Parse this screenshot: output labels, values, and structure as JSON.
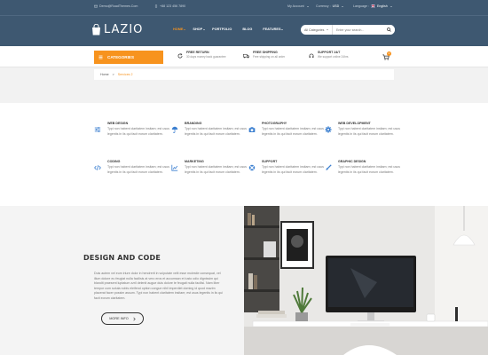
{
  "colors": {
    "header_bg": "#3e5871",
    "accent": "#f7931e",
    "band_bg": "#f2f2f2"
  },
  "topbar": {
    "email": "Demo@RoadThemes.Com",
    "phone": "+88 123 456 7890",
    "account": "My Account",
    "currency_label": "Currency :",
    "currency": "USD",
    "language_label": "Language :",
    "language": "English"
  },
  "header": {
    "logo": "LAZIO",
    "nav": [
      "HOME",
      "SHOP",
      "PORTFOLIO",
      "BLOG",
      "FEATURES"
    ],
    "search": {
      "category": "All Categories",
      "placeholder": "Enter your search..."
    }
  },
  "servicebar": {
    "categories_label": "CATEGORIES",
    "features": [
      {
        "title": "FREE RETURN",
        "subtitle": "30 days money back guarantee"
      },
      {
        "title": "FREE SHIPPING",
        "subtitle": "Free shipping on all order"
      },
      {
        "title": "SUPPORT 24/7",
        "subtitle": "We support online 24hrs"
      }
    ],
    "cart_count": "0"
  },
  "breadcrumb": {
    "home": "Home",
    "sep": ">",
    "current": "Services 2"
  },
  "services": [
    {
      "icon": "sliders-icon",
      "title": "WEB DESIGN",
      "desc": "Typi non habent claritatem insitam; est usus legentis in iis qui facit eorum claritatem."
    },
    {
      "icon": "umbrella-icon",
      "title": "BRANDING",
      "desc": "Typi non habent claritatem insitam; est usus legentis in iis qui facit eorum claritatem."
    },
    {
      "icon": "camera-icon",
      "title": "PHOTOGRAPHY",
      "desc": "Typi non habent claritatem insitam; est usus legentis in iis qui facit eorum claritatem."
    },
    {
      "icon": "gear-icon",
      "title": "WEB DEVELOPMENT",
      "desc": "Typi non habent claritatem insitam; est usus legentis in iis qui facit eorum claritatem."
    },
    {
      "icon": "code-icon",
      "title": "CODING",
      "desc": "Typi non habent claritatem insitam; est usus legentis in iis qui facit eorum claritatem."
    },
    {
      "icon": "chart-icon",
      "title": "MARKETING",
      "desc": "Typi non habent claritatem insitam; est usus legentis in iis qui facit eorum claritatem."
    },
    {
      "icon": "lifebuoy-icon",
      "title": "SUPPORT",
      "desc": "Typi non habent claritatem insitam; est usus legentis in iis qui facit eorum claritatem."
    },
    {
      "icon": "brush-icon",
      "title": "GRAPHIC DESIGN",
      "desc": "Typi non habent claritatem insitam; est usus legentis in iis qui facit eorum claritatem."
    }
  ],
  "design": {
    "title": "DESIGN AND CODE",
    "text": "Duis autem vel eum iriure dolor in hendrerit in vulputate velit esse molestie consequat, vel illum dolore eu feugiat nulla facilisis at vero eros et accumsan et iusto odio dignissim qui blandit praesent luptatum zzril delenit augue duis dolore te feugait nulla facilisi. Nam liber tempor cum soluta nobis eleifend option congue nihil imperdiet doming id quod mazim placerat facer possim assum. Typi non habent claritatem insitam; est usus legentis in iis qui facit eorum claritatem.",
    "button": "MORE INFO"
  }
}
